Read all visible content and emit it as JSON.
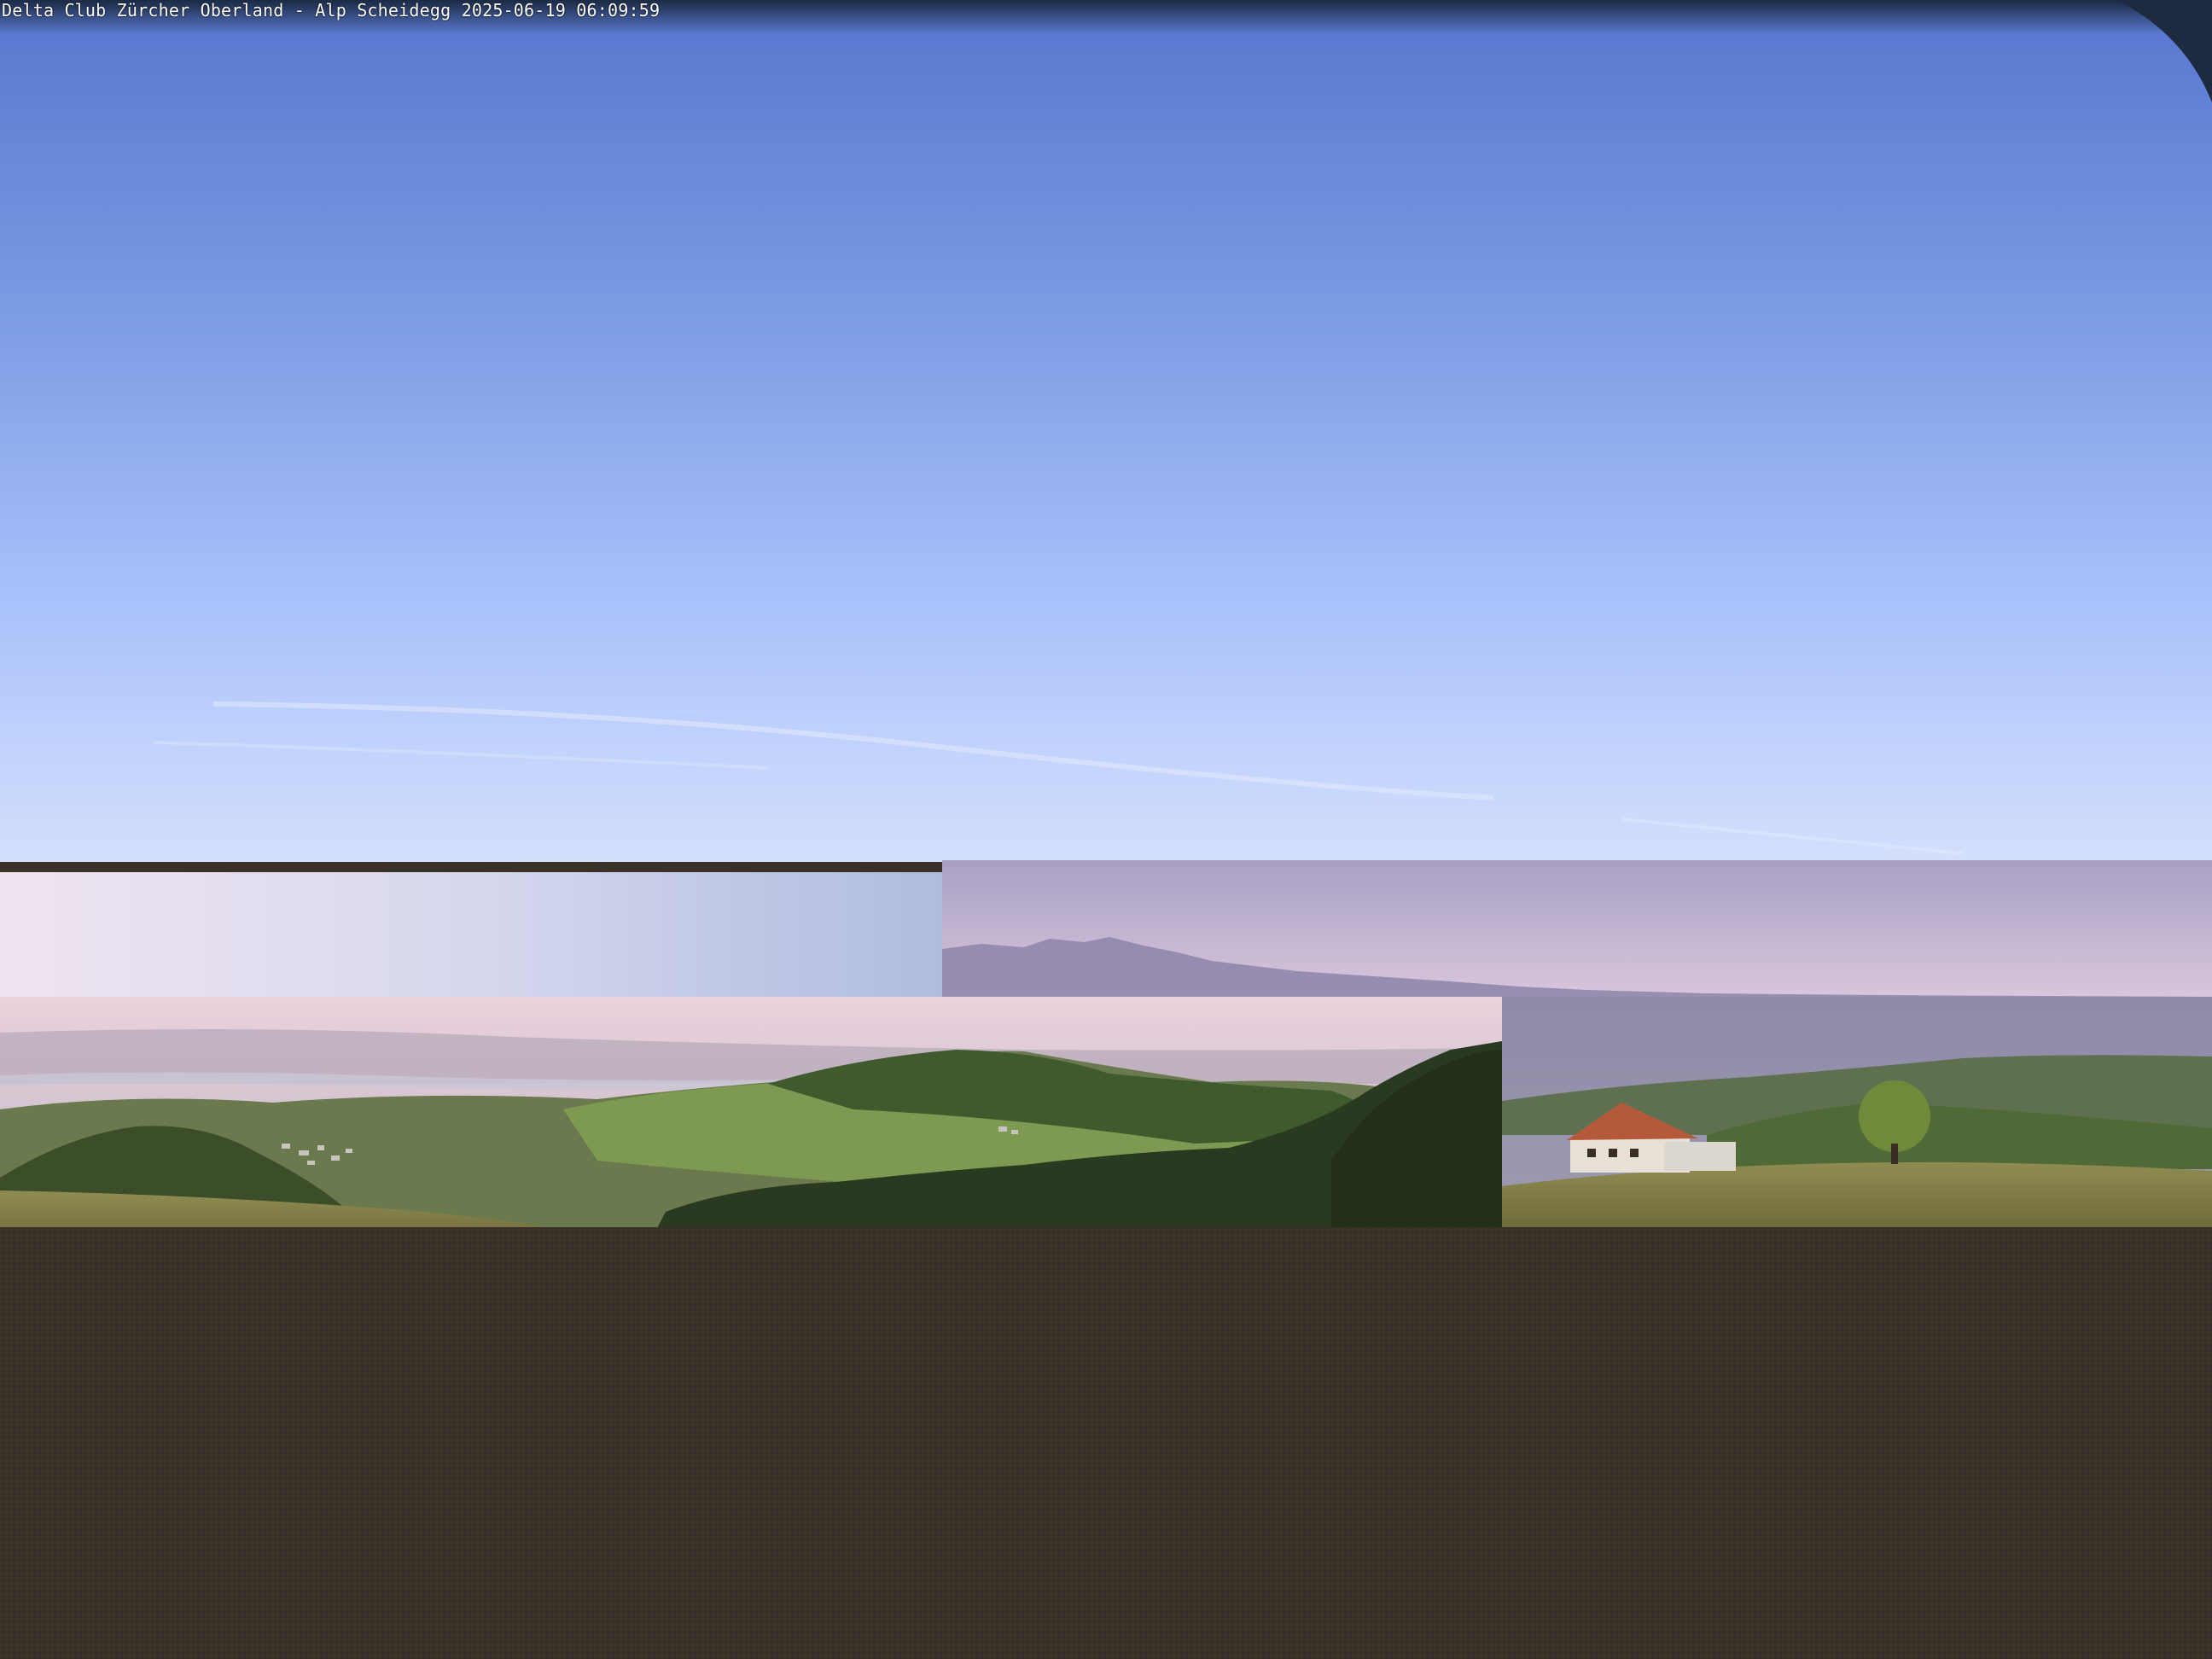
{
  "overlay": {
    "caption": "Delta Club Zürcher Oberland - Alp Scheidegg 2025-06-19 06:09:59"
  },
  "colors": {
    "sky_top": "#5a7fd2",
    "sky_horizon": "#cfdcfc",
    "haze_pink": "#e6cfd8",
    "haze_violet": "#b4a8c8",
    "hills_green": "#5a7a3e",
    "forest_dark": "#2c3a1e",
    "meadow": "#8e8a4c",
    "roof": "#b45a3a",
    "lower_fill": "#3a3129"
  }
}
